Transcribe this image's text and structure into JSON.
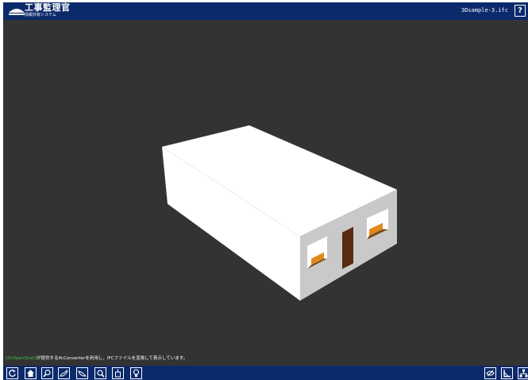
{
  "app": {
    "title": "工事監理官",
    "subtitle": "情報共有システム",
    "file_name": "3Dsample-3.ifc",
    "help_label": "?"
  },
  "info": {
    "link_text": "[IfcOpenShell]",
    "message": "が提供するIfcConverterを利用し、IFCファイルを変換して表示しています。"
  },
  "toolbar": {
    "left_tools": [
      {
        "name": "rotate-icon"
      },
      {
        "name": "home-icon"
      },
      {
        "name": "zoom-icon"
      },
      {
        "name": "pan-icon"
      },
      {
        "name": "orbit-icon"
      },
      {
        "name": "fit-icon"
      },
      {
        "name": "section-icon"
      },
      {
        "name": "light-icon"
      }
    ],
    "right_tools": [
      {
        "name": "visibility-icon"
      },
      {
        "name": "measure-icon"
      },
      {
        "name": "tree-icon"
      }
    ]
  },
  "colors": {
    "header_bg": "#0b2a6b",
    "viewport_bg": "#333333",
    "wall_white": "#ffffff",
    "wall_shade": "#c9c9c9",
    "door_brown": "#5a2a12",
    "window_orange": "#e08a1e",
    "link_green": "#3fbf3f"
  }
}
